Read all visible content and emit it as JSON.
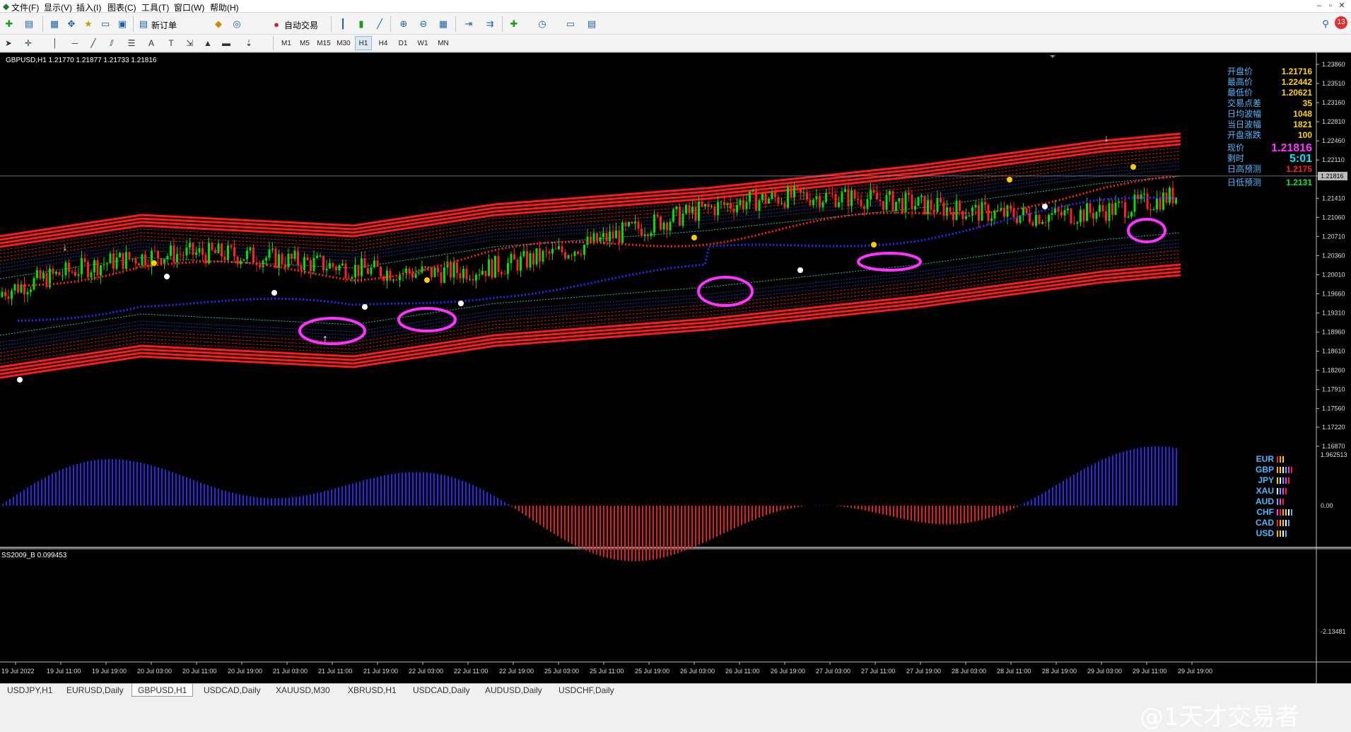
{
  "menu": {
    "items": [
      "文件(F)",
      "显示(V)",
      "插入(I)",
      "图表(C)",
      "工具(T)",
      "窗口(W)",
      "帮助(H)"
    ]
  },
  "toolbar": {
    "new_order": "新订单",
    "auto_trade": "自动交易"
  },
  "timeframes": [
    "M1",
    "M5",
    "M15",
    "M30",
    "H1",
    "H4",
    "D1",
    "W1",
    "MN"
  ],
  "active_timeframe": "H1",
  "chart": {
    "symbol_header": "GBPUSD,H1  1.21770 1.21877 1.21733 1.21816",
    "current_price": "1.21816",
    "price_axis": [
      "1.23860",
      "1.23510",
      "1.23160",
      "1.22810",
      "1.22460",
      "1.22110",
      "1.21816",
      "1.21410",
      "1.21060",
      "1.20710",
      "1.20360",
      "1.20010",
      "1.19660",
      "1.19310",
      "1.18960",
      "1.18610",
      "1.18260",
      "1.17910",
      "1.17560",
      "1.17220",
      "1.16870"
    ],
    "time_axis": [
      "19 Jul 2022",
      "19 Jul 11:00",
      "19 Jul 19:00",
      "20 Jul 03:00",
      "20 Jul 11:00",
      "20 Jul 19:00",
      "21 Jul 03:00",
      "21 Jul 11:00",
      "21 Jul 19:00",
      "22 Jul 03:00",
      "22 Jul 11:00",
      "22 Jul 19:00",
      "25 Jul 03:00",
      "25 Jul 11:00",
      "25 Jul 19:00",
      "26 Jul 03:00",
      "26 Jul 11:00",
      "26 Jul 19:00",
      "27 Jul 03:00",
      "27 Jul 11:00",
      "27 Jul 19:00",
      "28 Jul 03:00",
      "28 Jul 11:00",
      "28 Jul 19:00",
      "29 Jul 03:00",
      "29 Jul 11:00",
      "29 Jul 19:00"
    ]
  },
  "info_panel": [
    {
      "label": "开盘价",
      "value": "1.21716",
      "color": "#ffd400"
    },
    {
      "label": "最高价",
      "value": "1.22442",
      "color": "#ffd400"
    },
    {
      "label": "最低价",
      "value": "1.20621",
      "color": "#ffd400"
    },
    {
      "label": "交易点差",
      "value": "35",
      "color": "#ffd400"
    },
    {
      "label": "日均波幅",
      "value": "1048",
      "color": "#ffd400"
    },
    {
      "label": "当日波幅",
      "value": "1821",
      "color": "#ffd400"
    },
    {
      "label": "开盘涨跌",
      "value": "100",
      "color": "#ffd400"
    }
  ],
  "info_current": {
    "label": "现价",
    "value": "1.21816",
    "color": "#ff33ff"
  },
  "info_timer": {
    "label": "剩时",
    "value": "5:01",
    "color": "#00e5ff"
  },
  "info_high_forecast": {
    "label": "日高预测",
    "value": "1.2175",
    "color": "#ff2020"
  },
  "info_low_forecast": {
    "label": "日低预测",
    "value": "1.2131",
    "color": "#20e020"
  },
  "currencies": [
    "EUR",
    "GBP",
    "JPY",
    "XAU",
    "AUD",
    "CHF",
    "CAD",
    "USD"
  ],
  "oscillator": {
    "label": "SS2009_B 0.099453",
    "axis_top": "1.962513",
    "axis_zero": "0.00",
    "axis_bottom": "-2.13481"
  },
  "tabs": [
    "USDJPY,H1",
    "EURUSD,Daily",
    "GBPUSD,H1",
    "USDCAD,Daily",
    "XAUUSD,M30",
    "XBRUSD,H1",
    "USDCAD,Daily",
    "AUDUSD,Daily",
    "USDCHF,Daily"
  ],
  "active_tab": "GBPUSD,H1",
  "watermark": "@1天才交易者",
  "notification_count": "13",
  "colors": {
    "bull": "#00e000",
    "bear": "#ff2020",
    "band": "#ff1a1a",
    "osc_pos": "#2b2bdd",
    "osc_neg": "#dd2020",
    "circle": "#ff33ff",
    "ma_blue": "#2a2aff"
  }
}
